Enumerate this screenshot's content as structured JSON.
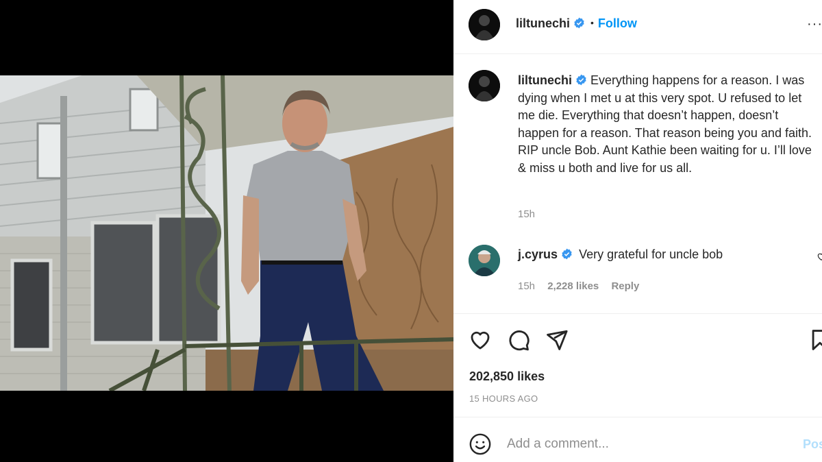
{
  "header": {
    "username": "liltunechi",
    "separator": "•",
    "follow_label": "Follow",
    "more_icon": "more-options-icon",
    "more_glyph": "···"
  },
  "caption": {
    "username": "liltunechi",
    "text": "Everything happens for a reason. I was dying when I met u at this very spot. U refused to let me die. Everything that doesn’t happen, doesn’t happen for a reason. That reason being you and faith. RIP uncle Bob. Aunt Kathie been waiting for u. I’ll love & miss u both and live for us all.",
    "time": "15h"
  },
  "comment": {
    "username": "j.cyrus",
    "text": "Very grateful for uncle bob",
    "time": "15h",
    "likes": "2,228 likes",
    "reply_label": "Reply"
  },
  "actions": {
    "icons": [
      "heart-icon",
      "comment-icon",
      "share-icon",
      "bookmark-icon"
    ],
    "likes": "202,850 likes",
    "time": "15 HOURS AGO"
  },
  "add_comment": {
    "placeholder": "Add a comment...",
    "post_label": "Post"
  },
  "colors": {
    "link_blue": "#0095f6",
    "verified_blue": "#3897f0",
    "post_disabled": "#b2dffc",
    "secondary_text": "#8e8e8e"
  }
}
